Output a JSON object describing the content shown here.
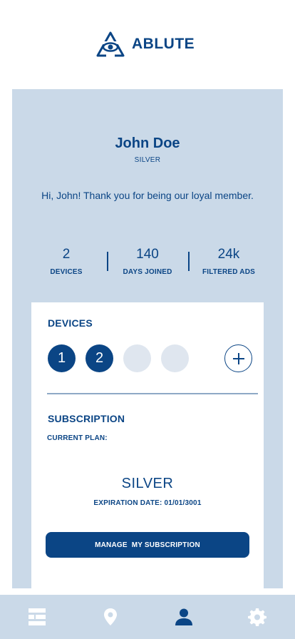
{
  "brand": {
    "name": "ABLUTE"
  },
  "profile": {
    "name": "John Doe",
    "tier": "SILVER",
    "greeting": "Hi, John! Thank you for being our loyal member."
  },
  "stats": [
    {
      "value": "2",
      "label": "DEVICES"
    },
    {
      "value": "140",
      "label": "DAYS JOINED"
    },
    {
      "value": "24k",
      "label": "FILTERED ADS"
    }
  ],
  "devices": {
    "title": "DEVICES",
    "slots": [
      "1",
      "2",
      "",
      ""
    ],
    "add_icon": "plus-icon"
  },
  "subscription": {
    "title": "SUBSCRIPTION",
    "current_plan_label": "CURRENT PLAN:",
    "plan_name": "SILVER",
    "expiration": "EXPIRATION DATE: 01/01/3001",
    "manage_button": "MANAGE  MY SUBSCRIPTION"
  },
  "nav": [
    {
      "icon": "list-icon",
      "active": false
    },
    {
      "icon": "location-pin-icon",
      "active": false
    },
    {
      "icon": "user-icon",
      "active": true
    },
    {
      "icon": "gear-icon",
      "active": false
    }
  ],
  "colors": {
    "primary": "#0b4585",
    "panel": "#cad9e8",
    "empty_slot": "#dfe6ef",
    "divider": "#8ea9c6",
    "card": "#ffffff"
  }
}
